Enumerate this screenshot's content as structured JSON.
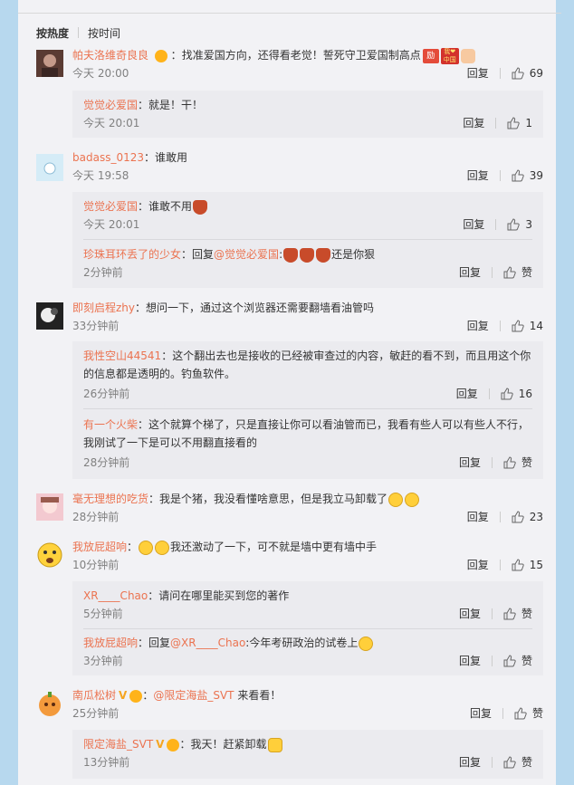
{
  "sort": {
    "hot": "按热度",
    "time": "按时间"
  },
  "labels": {
    "reply": "回复",
    "like": "赞",
    "reply_prefix": "回复"
  },
  "comments": [
    {
      "user": "帕夫洛维奇良良",
      "text": "找准爱国方向，还得看老觉！誓死守卫爱国制高点",
      "time": "今天 20:00",
      "likes": "69",
      "replies": [
        {
          "user": "觉觉必爱国",
          "text": "就是！干！",
          "time": "今天 20:01",
          "likes": "1"
        }
      ]
    },
    {
      "user": "badass_0123",
      "text": "谁敢用",
      "time": "今天 19:58",
      "likes": "39",
      "replies": [
        {
          "user": "觉觉必爱国",
          "text": "谁敢不用",
          "time": "今天 20:01",
          "likes": "3"
        },
        {
          "user": "珍珠耳环丢了的少女",
          "mention": "@觉觉必爱国",
          "text": "还是你狠",
          "time": "2分钟前",
          "likes": "赞"
        }
      ]
    },
    {
      "user": "即刻启程zhy",
      "text": "想问一下，通过这个浏览器还需要翻墙看油管吗",
      "time": "33分钟前",
      "likes": "14",
      "replies": [
        {
          "user": "我性空山44541",
          "text": "这个翻出去也是接收的已经被审查过的内容，敏赶的看不到，而且用这个你",
          "text2": "的信息都是透明的。钓鱼软件。",
          "time": "26分钟前",
          "likes": "16"
        },
        {
          "user": "有一个火柴",
          "text": "这个就算个梯了，只是直接让你可以看油管而已，我看有些人可以有些人不行，",
          "text2": "我刚试了一下是可以不用翻直接看的",
          "time": "28分钟前",
          "likes": "赞"
        }
      ]
    },
    {
      "user": "毫无理想的吃货",
      "text": "我是个猪，我没看懂啥意思，但是我立马卸载了",
      "time": "28分钟前",
      "likes": "23",
      "replies": []
    },
    {
      "user": "我放屁超响",
      "text": "我还激动了一下，可不就是墙中更有墙中手",
      "time": "10分钟前",
      "likes": "15",
      "replies": [
        {
          "user": "XR____Chao",
          "text": "请问在哪里能买到您的著作",
          "time": "5分钟前",
          "likes": "赞"
        },
        {
          "user": "我放屁超响",
          "mention": "@XR____Chao",
          "text": ":今年考研政治的试卷上",
          "time": "3分钟前",
          "likes": "赞"
        }
      ]
    },
    {
      "user": "南瓜松树",
      "mention": "@限定海盐_SVT",
      "text": "来看看！",
      "time": "25分钟前",
      "likes": "赞",
      "replies": [
        {
          "user": "限定海盐_SVT",
          "text": "我天！赶紧卸载",
          "time": "13分钟前",
          "likes": "赞"
        }
      ]
    }
  ],
  "colors": {
    "username": "#eb7350",
    "time": "#808080",
    "panel": "#f2f2f5",
    "subbox": "#ebebef",
    "page": "#b7d8ee"
  }
}
